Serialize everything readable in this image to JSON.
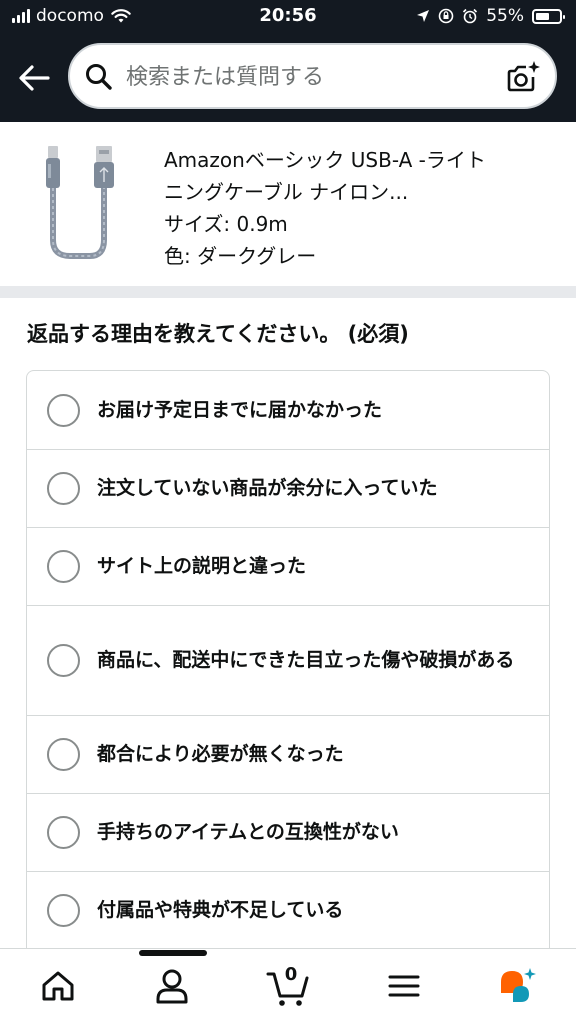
{
  "status_bar": {
    "carrier": "docomo",
    "time": "20:56",
    "battery": "55%"
  },
  "search": {
    "placeholder": "検索または質問する"
  },
  "product": {
    "title_line1": "Amazonベーシック USB-A -ライト",
    "title_line2": "ニングケーブル ナイロン...",
    "size": "サイズ: 0.9m",
    "color": "色: ダークグレー"
  },
  "question": "返品する理由を教えてください。 (必須)",
  "options": [
    {
      "label": "お届け予定日までに届かなかった"
    },
    {
      "label": "注文していない商品が余分に入っていた"
    },
    {
      "label": "サイト上の説明と違った"
    },
    {
      "label": "商品に、配送中にできた目立った傷や破損がある"
    },
    {
      "label": "都合により必要が無くなった"
    },
    {
      "label": "手持ちのアイテムとの互換性がない"
    },
    {
      "label": "付属品や特典が不足している"
    }
  ],
  "nav": {
    "cart_count": "0"
  },
  "colors": {
    "header_bg": "#131921",
    "accent_orange": "#ff6200",
    "accent_teal": "#1399b7"
  }
}
